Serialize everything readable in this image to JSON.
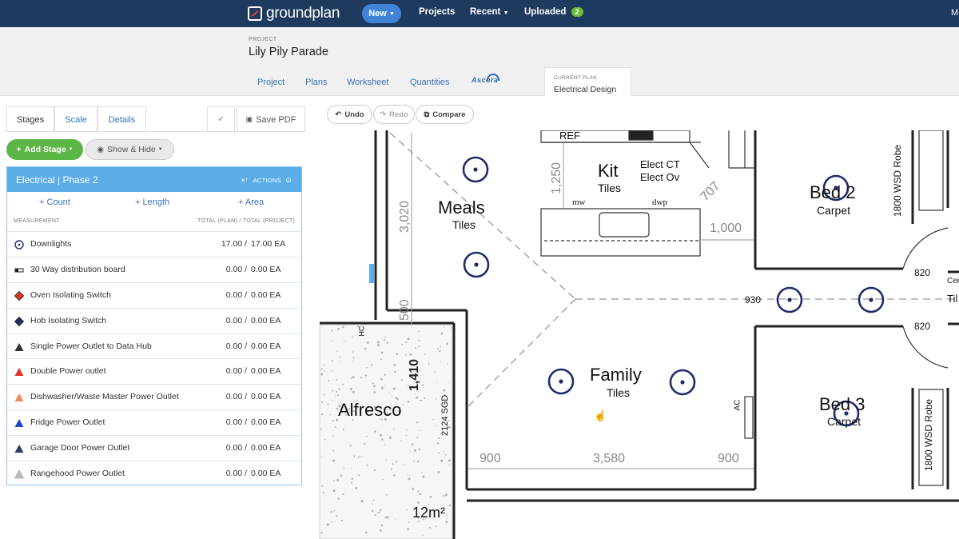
{
  "topnav": {
    "logo": "groundplan",
    "new_label": "New",
    "projects_label": "Projects",
    "recent_label": "Recent",
    "uploaded_label": "Uploaded",
    "uploaded_count": "2",
    "right_letter": "M"
  },
  "project": {
    "label": "PROJECT",
    "name": "Lily Pily Parade",
    "tabs": [
      "Project",
      "Plans",
      "Worksheet",
      "Quantities"
    ],
    "ascora_label": "Ascora",
    "current_plan_label": "CURRENT PLAN",
    "current_plan_name": "Electrical Design"
  },
  "panel_tabs": {
    "stages": "Stages",
    "scale": "Scale",
    "details": "Details",
    "save_pdf": "Save PDF"
  },
  "actions": {
    "add_stage": "Add Stage",
    "show_hide": "Show & Hide"
  },
  "stage": {
    "title": "Electrical | Phase 2",
    "actions_label": "ACTIONS",
    "count_label": "Count",
    "length_label": "Length",
    "area_label": "Area",
    "col_measurement": "MEASUREMENT",
    "col_totals": "TOTAL (PLAN) / TOTAL (PROJECT)",
    "rows": [
      {
        "name": "Downlights",
        "plan": "17.00 /",
        "project": "17.00 EA",
        "icon": "downlight-icon",
        "color": "#1f2d6b"
      },
      {
        "name": "30 Way distribution board",
        "plan": "0.00 /",
        "project": "0.00 EA",
        "icon": "distribution-board-icon",
        "color": "#222222"
      },
      {
        "name": "Oven Isolating Switch",
        "plan": "0.00 /",
        "project": "0.00 EA",
        "icon": "diamond-red-icon",
        "color": "#e0342a"
      },
      {
        "name": "Hob Isolating Switch",
        "plan": "0.00 /",
        "project": "0.00 EA",
        "icon": "diamond-navy-icon",
        "color": "#1f2d6b"
      },
      {
        "name": "Single Power Outlet to Data Hub",
        "plan": "0.00 /",
        "project": "0.00 EA",
        "icon": "triangle-dark-icon",
        "color": "#333333"
      },
      {
        "name": "Double Power outlet",
        "plan": "0.00 /",
        "project": "0.00 EA",
        "icon": "triangle-red-icon",
        "color": "#e0342a"
      },
      {
        "name": "Dishwasher/Waste Master Power Outlet",
        "plan": "0.00 /",
        "project": "0.00 EA",
        "icon": "triangle-orange-icon",
        "color": "#f08a60"
      },
      {
        "name": "Fridge Power Outlet",
        "plan": "0.00 /",
        "project": "0.00 EA",
        "icon": "triangle-blue-icon",
        "color": "#1f47c8"
      },
      {
        "name": "Garage Door Power Outlet",
        "plan": "0.00 /",
        "project": "0.00 EA",
        "icon": "triangle-navy-icon",
        "color": "#2b3a6b"
      },
      {
        "name": "Rangehood Power Outlet",
        "plan": "0.00 /",
        "project": "0.00 EA",
        "icon": "triangle-grey-icon",
        "color": "#bbbbbb"
      }
    ]
  },
  "toolbar": {
    "undo": "Undo",
    "redo": "Redo",
    "compare": "Compare"
  },
  "floorplan": {
    "rooms": {
      "meals": "Meals",
      "meals_floor": "Tiles",
      "kit": "Kit",
      "kit_floor": "Tiles",
      "family": "Family",
      "family_floor": "Tiles",
      "bed2": "Bed 2",
      "bed2_floor": "Carpet",
      "bed3": "Bed 3",
      "bed3_floor": "Carpet",
      "alfresco": "Alfresco",
      "alfresco_area": "12m²"
    },
    "labels": {
      "ref": "REF",
      "elect_ct": "Elect CT",
      "elect_ov": "Elect Ov",
      "mw": "mw",
      "dwp": "dwp",
      "ac": "AC",
      "hc": "HC",
      "robe1": "1800 WSD Robe",
      "robe2": "1800 WSD Robe",
      "sgd": "2124 SGD",
      "cer": "Cer",
      "til": "Til"
    },
    "dimensions": {
      "d1250": "1,250",
      "d3020": "3,020",
      "d707": "707",
      "d1000": "1,000",
      "d500": "500",
      "d1410": "1,410",
      "d930": "930",
      "d820a": "820",
      "d820b": "820",
      "d900a": "900",
      "d3580": "3,580",
      "d900b": "900"
    },
    "downlights_count": 8,
    "marker_color": "#1f2d6b"
  }
}
